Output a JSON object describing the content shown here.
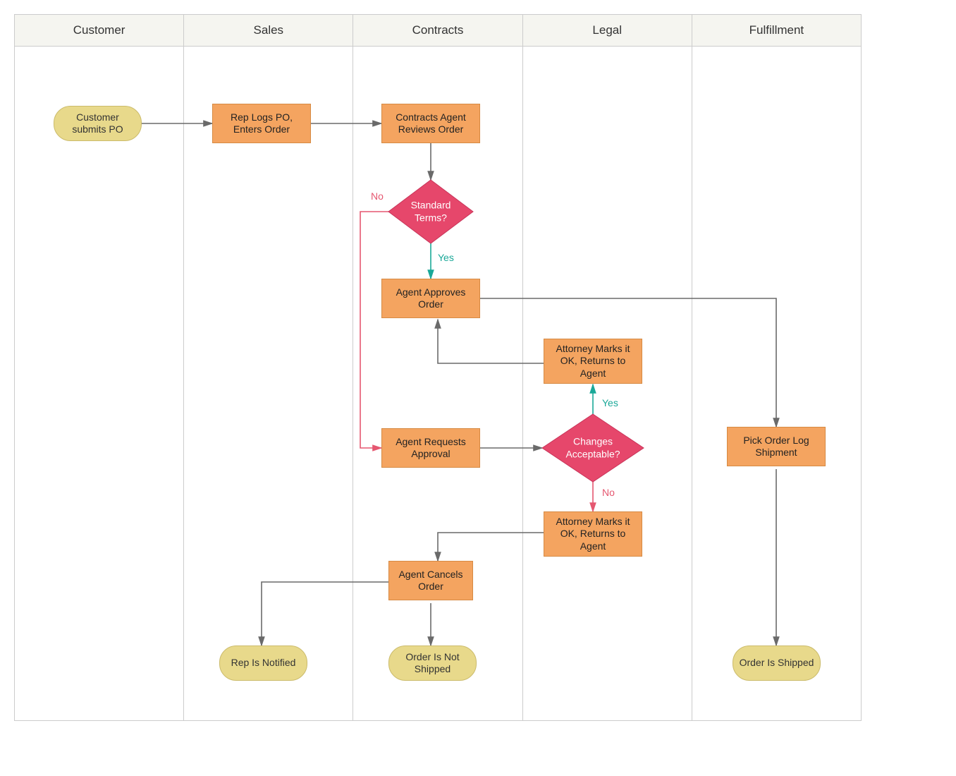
{
  "lanes": {
    "l0": "Customer",
    "l1": "Sales",
    "l2": "Contracts",
    "l3": "Legal",
    "l4": "Fulfillment"
  },
  "nodes": {
    "customerSubmits": "Customer submits PO",
    "repLogs": "Rep Logs PO, Enters Order",
    "contractsReview": "Contracts Agent Reviews Order",
    "standardTerms": "Standard Terms?",
    "agentApproves": "Agent Approves Order",
    "agentRequests": "Agent Requests Approval",
    "changesAcceptable": "Changes Acceptable?",
    "attorneyOkYes": "Attorney Marks it OK, Returns to Agent",
    "attorneyOkNo": "Attorney Marks it OK, Returns to Agent",
    "agentCancels": "Agent Cancels Order",
    "repNotified": "Rep Is Notified",
    "orderNotShipped": "Order Is Not Shipped",
    "pickOrder": "Pick Order Log Shipment",
    "orderShipped": "Order Is Shipped"
  },
  "labels": {
    "yes": "Yes",
    "no": "No"
  },
  "colors": {
    "terminator": "#e8d98b",
    "process": "#f4a460",
    "decision": "#e6476b",
    "arrowDefault": "#6a6a6a",
    "arrowYes": "#1aa898",
    "arrowNo": "#e55770"
  }
}
